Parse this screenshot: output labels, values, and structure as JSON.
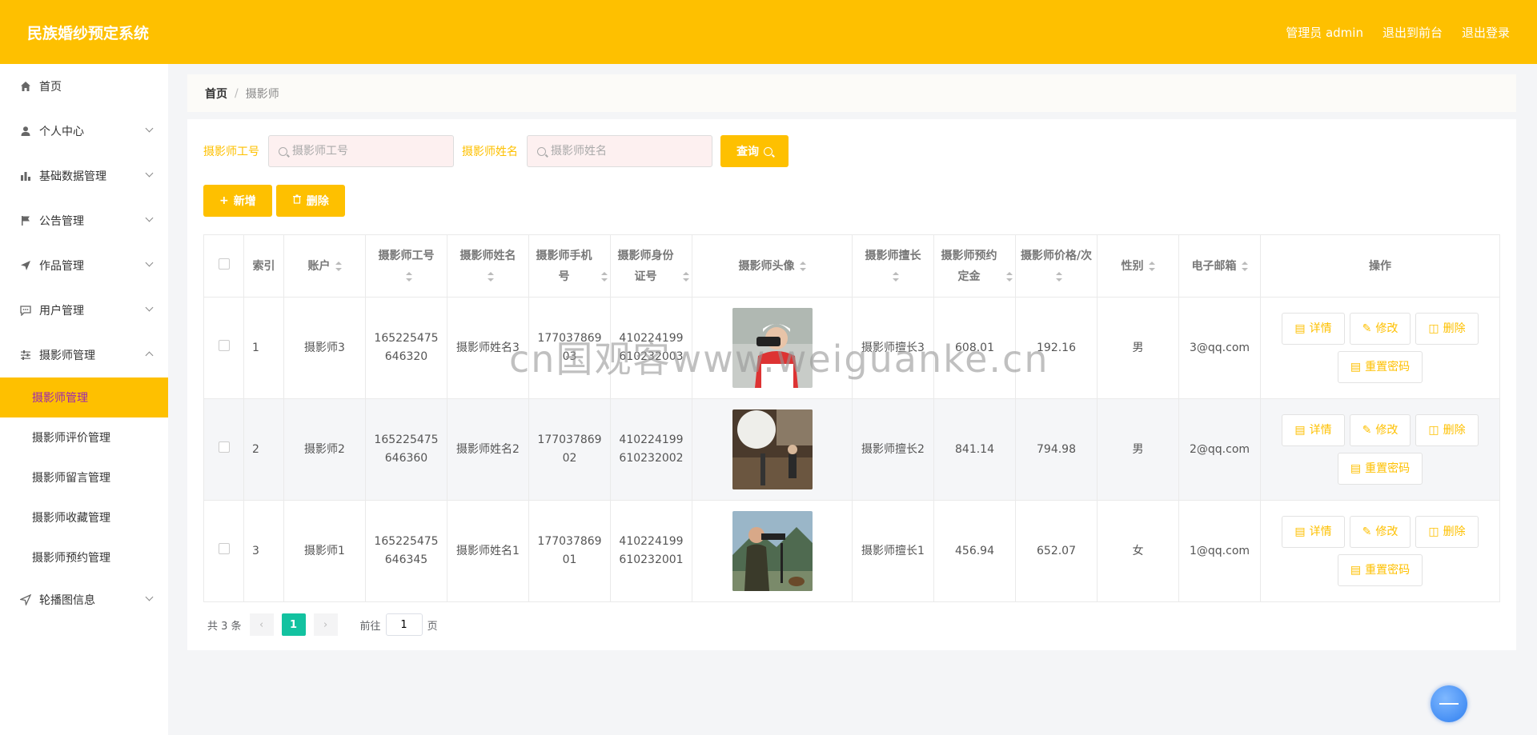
{
  "app": {
    "title": "民族婚纱预定系统"
  },
  "header": {
    "links": [
      "管理员 admin",
      "退出到前台",
      "退出登录"
    ]
  },
  "sidebar": {
    "items": [
      {
        "label": "首页",
        "icon": "home-icon",
        "expandable": false
      },
      {
        "label": "个人中心",
        "icon": "user-icon",
        "expandable": true
      },
      {
        "label": "基础数据管理",
        "icon": "bar-chart-icon",
        "expandable": true
      },
      {
        "label": "公告管理",
        "icon": "flag-icon",
        "expandable": true
      },
      {
        "label": "作品管理",
        "icon": "send-icon",
        "expandable": true
      },
      {
        "label": "用户管理",
        "icon": "chat-icon",
        "expandable": true
      },
      {
        "label": "摄影师管理",
        "icon": "sliders-icon",
        "expandable": true,
        "expanded": true,
        "children": [
          "摄影师管理",
          "摄影师评价管理",
          "摄影师留言管理",
          "摄影师收藏管理",
          "摄影师预约管理"
        ],
        "active_child": "摄影师管理"
      },
      {
        "label": "轮播图信息",
        "icon": "navigation-icon",
        "expandable": true
      }
    ]
  },
  "breadcrumb": {
    "home": "首页",
    "separator": "/",
    "current": "摄影师"
  },
  "search": {
    "fields": [
      {
        "label": "摄影师工号",
        "placeholder": "摄影师工号"
      },
      {
        "label": "摄影师姓名",
        "placeholder": "摄影师姓名"
      }
    ],
    "button": "查询"
  },
  "actions": {
    "add": "新增",
    "delete": "删除"
  },
  "table": {
    "headers": [
      "索引",
      "账户",
      "摄影师工号",
      "摄影师姓名",
      "摄影师手机号",
      "摄影师身份证号",
      "摄影师头像",
      "摄影师擅长",
      "摄影师预约定金",
      "摄影师价格/次",
      "性别",
      "电子邮箱",
      "操作"
    ],
    "rows": [
      {
        "index": "1",
        "account": "摄影师3",
        "job_no": "165225475646320",
        "name": "摄影师姓名3",
        "phone": "17703786903",
        "id_card": "410224199610232003",
        "specialty": "摄影师擅长3",
        "deposit": "608.01",
        "price": "192.16",
        "gender": "男",
        "email": "3@qq.com"
      },
      {
        "index": "2",
        "account": "摄影师2",
        "job_no": "165225475646360",
        "name": "摄影师姓名2",
        "phone": "17703786902",
        "id_card": "410224199610232002",
        "specialty": "摄影师擅长2",
        "deposit": "841.14",
        "price": "794.98",
        "gender": "男",
        "email": "2@qq.com"
      },
      {
        "index": "3",
        "account": "摄影师1",
        "job_no": "165225475646345",
        "name": "摄影师姓名1",
        "phone": "17703786901",
        "id_card": "410224199610232001",
        "specialty": "摄影师擅长1",
        "deposit": "456.94",
        "price": "652.07",
        "gender": "女",
        "email": "1@qq.com"
      }
    ],
    "row_actions": [
      "详情",
      "修改",
      "删除",
      "重置密码"
    ]
  },
  "pagination": {
    "total": "共 3 条",
    "current": "1",
    "goto_prefix": "前往",
    "goto_value": "1",
    "goto_suffix": "页"
  },
  "watermark": "cn国观客www.weiguanke.cn",
  "colors": {
    "primary": "#fec000",
    "active_text": "#9c27b0",
    "page_active": "#13c2a0"
  }
}
